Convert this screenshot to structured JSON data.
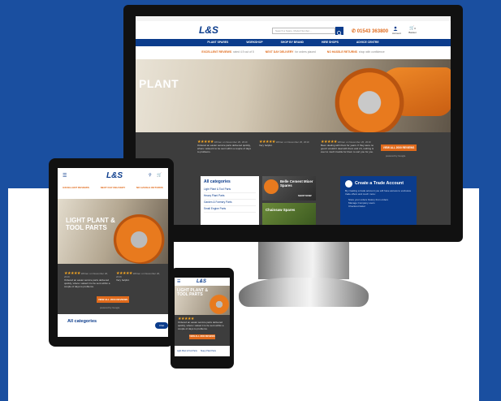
{
  "brand": {
    "logo": "L&S",
    "blue": "#0b3c8c",
    "orange": "#e06a1b",
    "background": "#1a4fa0"
  },
  "desktop": {
    "search_placeholder": "Search a Spare, Model Number...",
    "phone": "01543 363800",
    "account_label": "Account",
    "basket_label": "Basket",
    "basket_count": "0",
    "nav": [
      "PLANT SPARES",
      "WORKSHOP",
      "SHOP BY BRAND",
      "HIRE SHOPS",
      "ADVICE CENTRE"
    ],
    "usps": [
      {
        "title": "EXCELLENT REVIEWS",
        "sub": "rated 4.9 out of 5"
      },
      {
        "title": "NEXT DAY DELIVERY",
        "sub": "for orders placed"
      },
      {
        "title": "NO HASSLE RETURNS",
        "sub": "shop with confidence"
      }
    ],
    "hero_title": "PLANT",
    "reviews": [
      {
        "stars": "★★★★★",
        "date": "Written on November 26, 2019",
        "text": "Ordered an easier service parts delivered quickly, where i asked it to be sent within a couple of days to problems."
      },
      {
        "stars": "★★★★★",
        "date": "Written on November 26, 2019",
        "text": "Very helpful."
      },
      {
        "stars": "★★★★★",
        "date": "Written on November 26, 2019",
        "text": "Been dealing with them for years. If they were no good I wouldn't deal with them and LS, nothing is ever to much trouble for them to sort you for you."
      }
    ],
    "reviews_button": "VIEW ALL 2000 REVIEWS",
    "powered_by": "powered by Google",
    "categories_title": "All categories",
    "categories": [
      "Light Plant & Tool Parts",
      "Heavy Plant Parts",
      "Garden & Forestry Parts",
      "Small Engine Parts"
    ],
    "tile1_title": "Belle Cement Mixer Spares",
    "tile1_button": "SHOP NOW",
    "tile2_title": "Chainsaw Spares",
    "trade_title": "Create a Trade Account",
    "trade_text": "By creating a trade account you will have access to exclusive trade offers and much more:",
    "trade_points": [
      "Store your orders history from orders",
      "Manage Company users",
      "Checkout faster"
    ]
  },
  "tablet": {
    "usps": [
      "EXCELLENT REVIEWS",
      "NEXT DAY DELIVERY",
      "NO HASSLE RETURNS"
    ],
    "hero_title": "LIGHT PLANT & TOOL PARTS",
    "reviews_button": "VIEW ALL 2000 REVIEWS",
    "powered_by": "powered by Google",
    "categories_title": "All categories",
    "chat": "Chat"
  },
  "phone": {
    "hero_title": "LIGHT PLANT & TOOL PARTS",
    "reviews_button": "VIEW ALL 2000 REVIEWS",
    "footer_items": [
      "Light Plant & Tool Parts",
      "Heavy Plant Parts"
    ]
  }
}
